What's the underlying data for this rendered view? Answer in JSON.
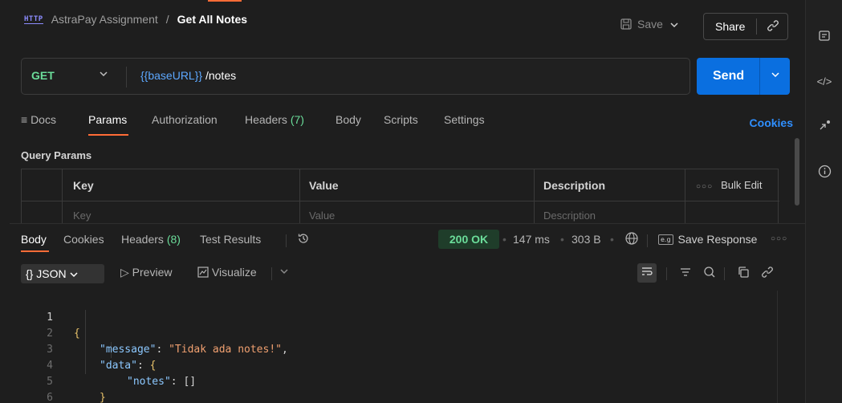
{
  "header": {
    "http_badge": "HTTP",
    "collection": "AstraPay Assignment",
    "separator": "/",
    "request_name": "Get All Notes",
    "save_label": "Save",
    "share_label": "Share"
  },
  "request": {
    "method": "GET",
    "url_variable": "{{baseURL}}",
    "url_path": " /notes",
    "send_label": "Send"
  },
  "tabs": {
    "docs": "Docs",
    "params": "Params",
    "authorization": "Authorization",
    "headers": "Headers",
    "headers_count": "(7)",
    "body": "Body",
    "scripts": "Scripts",
    "settings": "Settings",
    "cookies": "Cookies"
  },
  "query_params": {
    "title": "Query Params",
    "columns": [
      "Key",
      "Value",
      "Description"
    ],
    "placeholders": [
      "Key",
      "Value",
      "Description"
    ],
    "bulk_edit": "Bulk Edit"
  },
  "response": {
    "tabs": {
      "body": "Body",
      "cookies": "Cookies",
      "headers": "Headers",
      "headers_count": "(8)",
      "test_results": "Test Results"
    },
    "status": "200 OK",
    "time": "147 ms",
    "size": "303 B",
    "save_response": "Save Response",
    "format": "JSON",
    "preview": "Preview",
    "visualize": "Visualize",
    "code_lines": [
      {
        "n": "1"
      },
      {
        "n": "2",
        "key": "\"message\"",
        "colon": ": ",
        "value": "\"Tidak ada notes!\"",
        "end": ","
      },
      {
        "n": "3",
        "key": "\"data\"",
        "colon": ": ",
        "brace": "{"
      },
      {
        "n": "4",
        "key": "\"notes\"",
        "colon": ": ",
        "rest": "[]"
      },
      {
        "n": "5",
        "brace": "}"
      },
      {
        "n": "6",
        "brace": "}"
      }
    ]
  },
  "colors": {
    "accent": "#ff6c37",
    "send_blue": "#0a6fe0",
    "method_green": "#6bdd9a",
    "link_blue": "#2f8fff"
  }
}
